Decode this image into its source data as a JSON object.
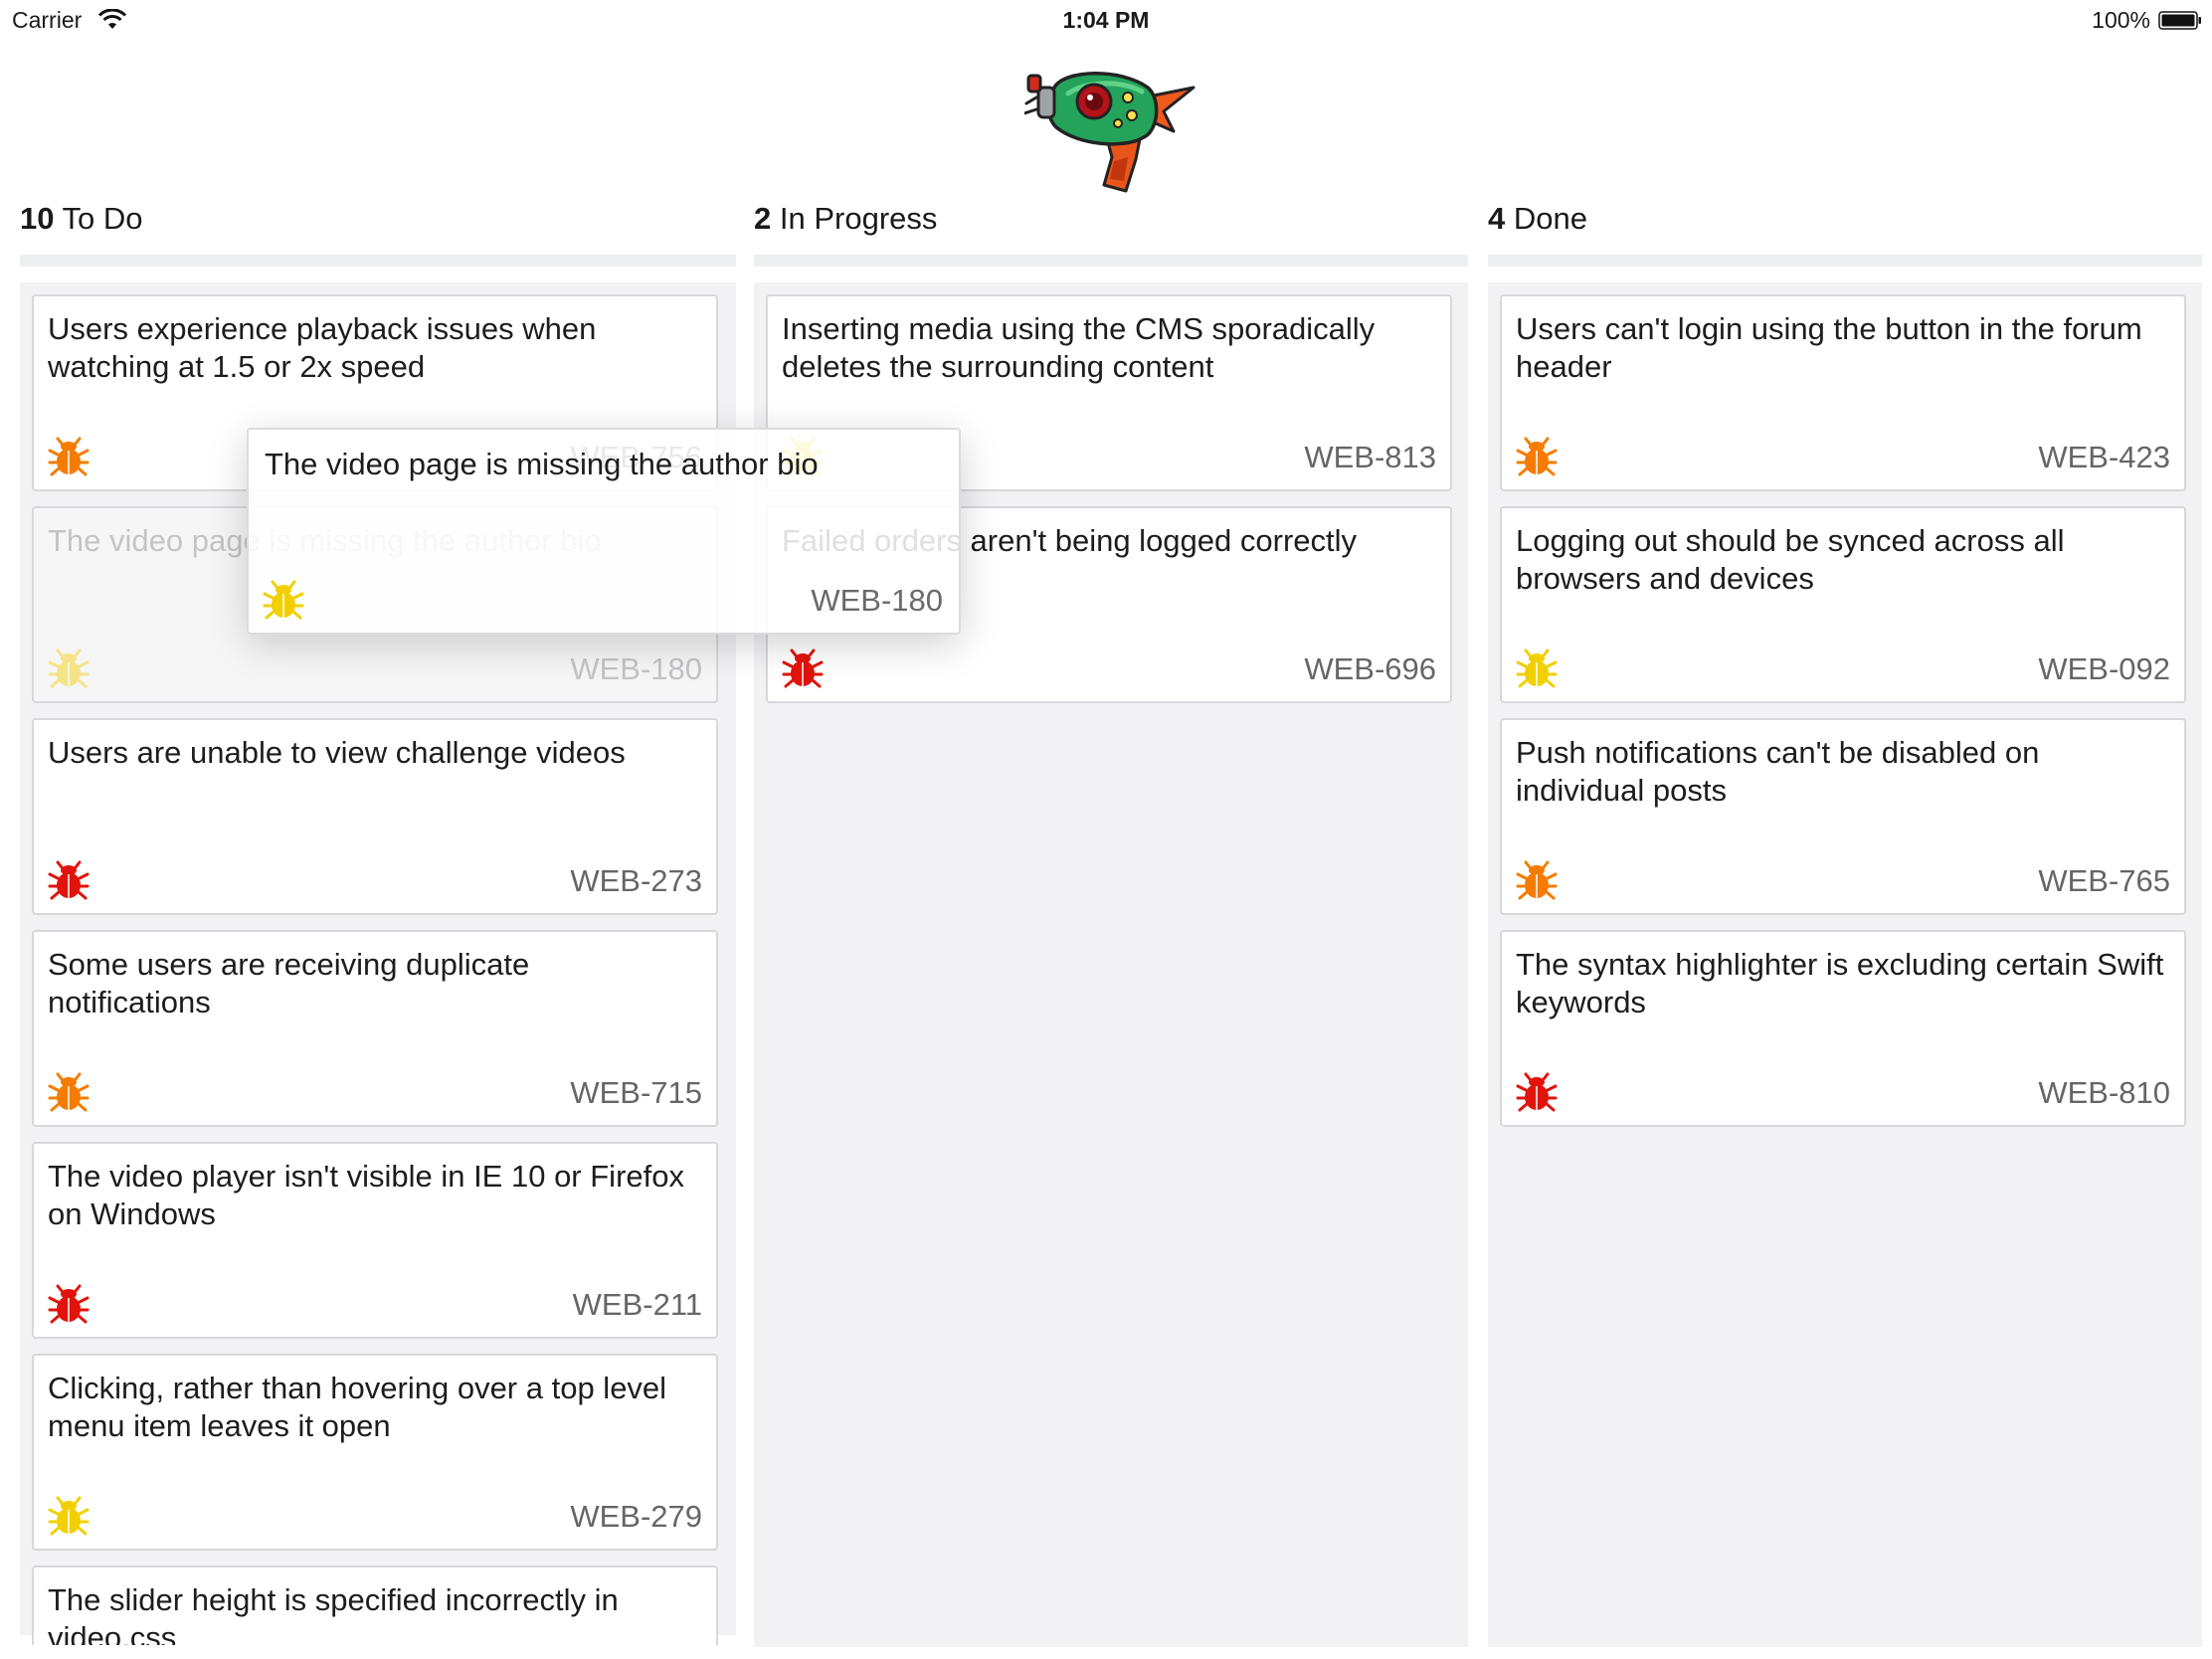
{
  "status_bar": {
    "carrier": "Carrier",
    "time": "1:04 PM",
    "battery": "100%"
  },
  "colors": {
    "bug_orange": "#f57c00",
    "bug_red": "#e0140c",
    "bug_yellow": "#f2d000"
  },
  "columns": [
    {
      "count": "10",
      "name": "To Do",
      "cards": [
        {
          "title": "Users experience playback issues when watching at 1.5 or 2x speed",
          "id": "WEB-756",
          "severity": "orange"
        },
        {
          "title": "The video page is missing the author bio",
          "id": "WEB-180",
          "severity": "yellow",
          "state": "drag-placeholder"
        },
        {
          "title": "Users are unable to view challenge videos",
          "id": "WEB-273",
          "severity": "red"
        },
        {
          "title": "Some users are receiving duplicate notifications",
          "id": "WEB-715",
          "severity": "orange"
        },
        {
          "title": "The video player isn't visible in IE 10 or Firefox on Windows",
          "id": "WEB-211",
          "severity": "red"
        },
        {
          "title": "Clicking, rather than hovering over a top level menu item leaves it open",
          "id": "WEB-279",
          "severity": "yellow"
        },
        {
          "title": "The slider height is specified incorrectly in video.css"
        }
      ]
    },
    {
      "count": "2",
      "name": "In Progress",
      "cards": [
        {
          "title": "Inserting media using the CMS sporadically deletes the surrounding content",
          "id": "WEB-813",
          "severity": "yellow"
        },
        {
          "title": "Failed orders aren't being logged correctly",
          "id": "WEB-696",
          "severity": "red"
        }
      ]
    },
    {
      "count": "4",
      "name": "Done",
      "cards": [
        {
          "title": "Users can't login using the button in the forum header",
          "id": "WEB-423",
          "severity": "orange"
        },
        {
          "title": "Logging out should be synced across all browsers and devices",
          "id": "WEB-092",
          "severity": "yellow"
        },
        {
          "title": "Push notifications can't be disabled on individual posts",
          "id": "WEB-765",
          "severity": "orange"
        },
        {
          "title": "The syntax highlighter is excluding certain Swift keywords",
          "id": "WEB-810",
          "severity": "red"
        }
      ]
    }
  ],
  "dragging_card": {
    "title": "The video page is missing the author bio",
    "id": "WEB-180",
    "severity": "yellow"
  }
}
